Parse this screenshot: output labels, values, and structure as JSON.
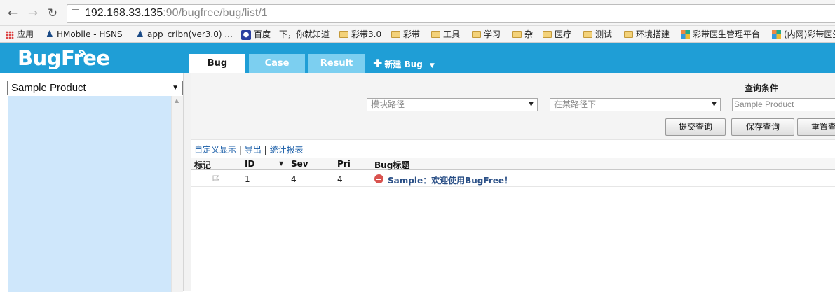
{
  "browser": {
    "url_host": "192.168.33.135",
    "url_rest": ":90/bugfree/bug/list/1",
    "bookmarks": [
      {
        "label": "应用",
        "icon": "apps-icon"
      },
      {
        "label": "HMobile - HSNS",
        "icon": "person-icon"
      },
      {
        "label": "app_cribn(ver3.0) ...",
        "icon": "person-icon"
      },
      {
        "label": "百度一下，你就知道",
        "icon": "paw-icon"
      },
      {
        "label": "彩带3.0",
        "icon": "folder-icon"
      },
      {
        "label": "彩带",
        "icon": "folder-icon"
      },
      {
        "label": "工具",
        "icon": "folder-icon"
      },
      {
        "label": "学习",
        "icon": "folder-icon"
      },
      {
        "label": "杂",
        "icon": "folder-icon"
      },
      {
        "label": "医疗",
        "icon": "folder-icon"
      },
      {
        "label": "测试",
        "icon": "folder-icon"
      },
      {
        "label": "环境搭建",
        "icon": "folder-icon"
      },
      {
        "label": "彩带医生管理平台",
        "icon": "grid-icon"
      },
      {
        "label": "(内网)彩带医生",
        "icon": "grid-icon"
      }
    ]
  },
  "app": {
    "logo": "BugFree",
    "tabs": [
      {
        "label": "Bug",
        "active": true
      },
      {
        "label": "Case",
        "active": false
      },
      {
        "label": "Result",
        "active": false
      }
    ],
    "new_bug_label": "新建 Bug"
  },
  "sidebar": {
    "product_select_value": "Sample Product"
  },
  "query": {
    "title": "查询条件",
    "field1": "模块路径",
    "field2": "在某路径下",
    "field3": "Sample Product",
    "buttons": {
      "submit": "提交查询",
      "save": "保存查询",
      "reset": "重置查询"
    }
  },
  "links": {
    "custom_display": "自定义显示",
    "export": "导出",
    "report": "统计报表",
    "sep": "|"
  },
  "grid": {
    "columns": {
      "mark": "标记",
      "id": "ID",
      "sev": "Sev",
      "pri": "Pri",
      "title": "Bug标题"
    },
    "rows": [
      {
        "id": "1",
        "sev": "4",
        "pri": "4",
        "title": "Sample：欢迎使用BugFree！"
      }
    ]
  },
  "colors": {
    "header_blue": "#1f9ed6",
    "tab_inactive": "#7ccff0",
    "tree_bg": "#cfe7fb",
    "link_blue": "#1a5ea8"
  }
}
